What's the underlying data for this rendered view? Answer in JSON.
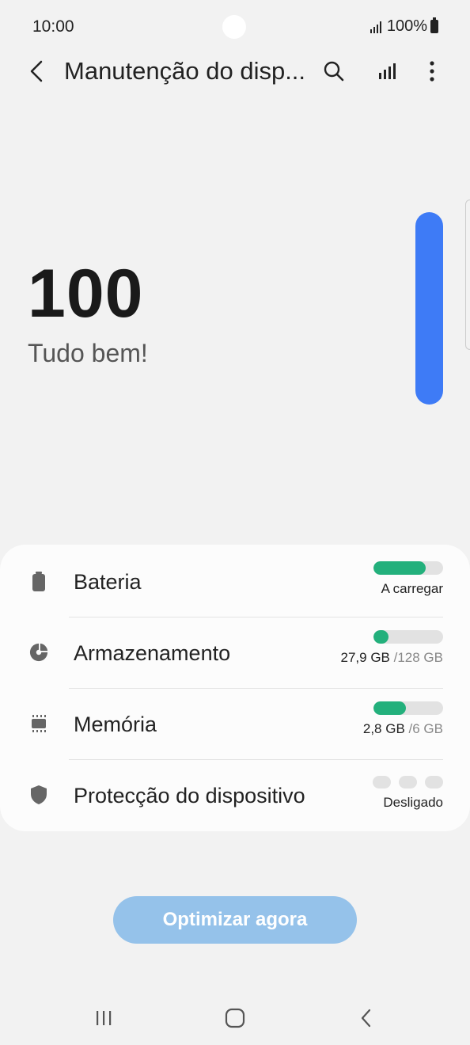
{
  "status_bar": {
    "time": "10:00",
    "battery": "100%"
  },
  "app_bar": {
    "title": "Manutenção do disp..."
  },
  "score": {
    "value": "100",
    "status": "Tudo bem!",
    "level_fraction": 1.0
  },
  "items": [
    {
      "label": "Bateria",
      "value": "A carregar",
      "value_muted": "",
      "progress": 0.75,
      "icon": "battery-icon"
    },
    {
      "label": "Armazenamento",
      "value": "27,9 GB",
      "value_muted": "/128 GB",
      "progress": 0.22,
      "icon": "pie-chart-icon"
    },
    {
      "label": "Memória",
      "value": "2,8 GB",
      "value_muted": "/6 GB",
      "progress": 0.47,
      "icon": "memory-chip-icon"
    },
    {
      "label": "Protecção do dispositivo",
      "value": "Desligado",
      "value_muted": "",
      "icon": "shield-icon"
    }
  ],
  "optimize_button": {
    "label": "Optimizar agora"
  },
  "colors": {
    "accent_blue": "#3e7bf6",
    "progress_green": "#23b07c",
    "button_disabled": "#95c2ea"
  }
}
